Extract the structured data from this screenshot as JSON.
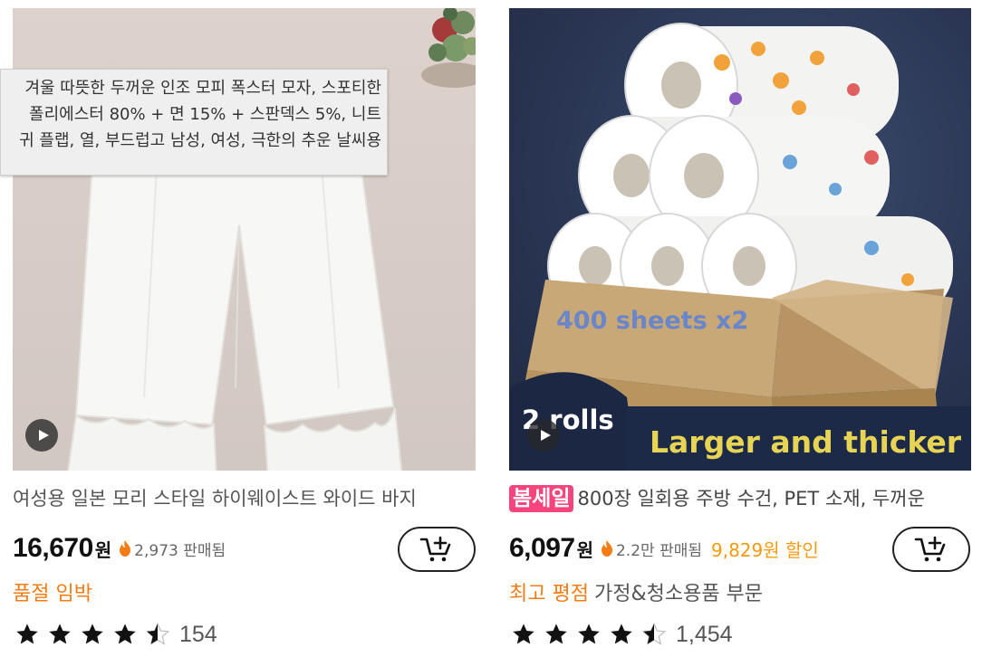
{
  "products": [
    {
      "title": "여성용 일본 모리 스타일 하이웨이스트 와이드 바지",
      "price": "16,670",
      "currency": "원",
      "sold": "2,973 판매됨",
      "tag": "품절 임박",
      "rating": 4.5,
      "review_count": "154",
      "cart_icon": "add-to-cart-icon",
      "image_desc_icon": "pants-image",
      "tooltip_lines": [
        "겨울 따뜻한 두꺼운 인조 모피 폭스터 모자, 스포티한",
        "폴리에스터 80% + 면 15% + 스판덱스 5%, 니트",
        "귀 플랩, 열, 부드럽고 남성, 여성, 극한의 추운 날씨용"
      ]
    },
    {
      "sale_badge": "봄세일",
      "title": "800장 일회용 주방 수건, PET 소재, 두꺼운",
      "price": "6,097",
      "currency": "원",
      "sold": "2.2만 판매됨",
      "discount": "9,829원 할인",
      "tag": "최고 평점",
      "tag_category": "가정&청소용품 부문",
      "rating": 4.5,
      "review_count": "1,454",
      "image_text_sheets": "400 sheets x2",
      "image_text_rolls": "2 rolls",
      "image_text_larger": "Larger and thicker",
      "cart_icon": "add-to-cart-icon"
    }
  ],
  "colors": {
    "accent_orange": "#f57c14",
    "discount_orange": "#f59a0b",
    "sale_pink": "#f5457c"
  }
}
